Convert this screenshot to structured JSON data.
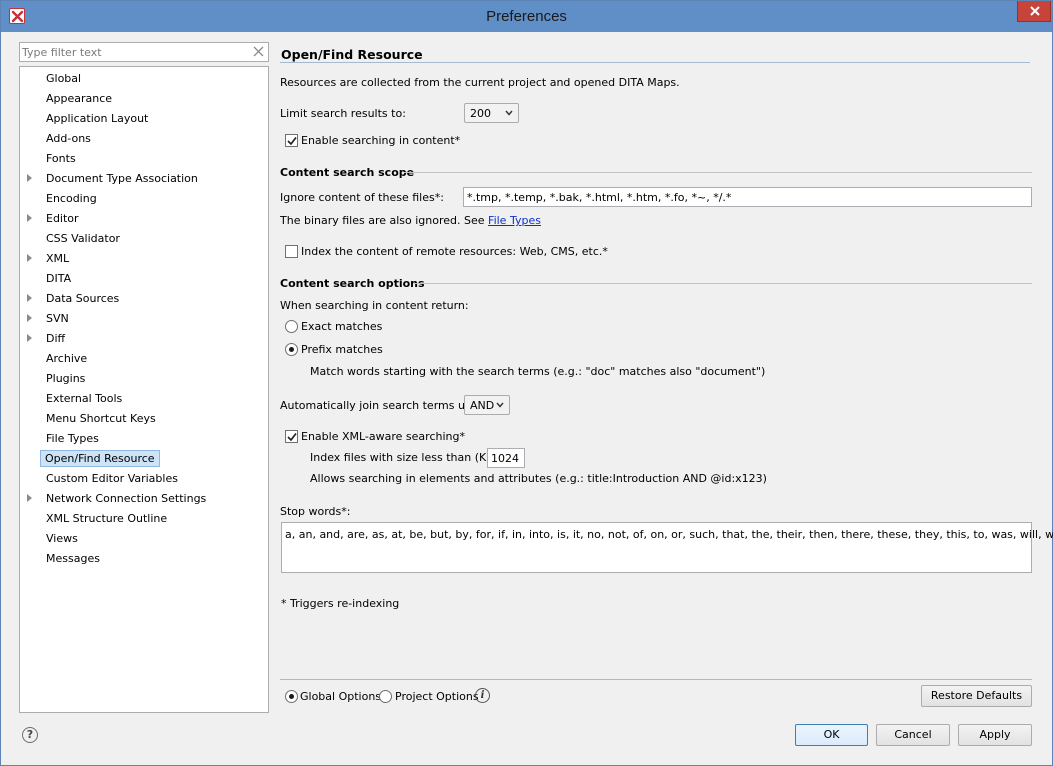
{
  "window": {
    "title": "Preferences"
  },
  "filter": {
    "placeholder": "Type filter text"
  },
  "tree": [
    {
      "label": "Global",
      "expandable": false
    },
    {
      "label": "Appearance",
      "expandable": false
    },
    {
      "label": "Application Layout",
      "expandable": false
    },
    {
      "label": "Add-ons",
      "expandable": false
    },
    {
      "label": "Fonts",
      "expandable": false
    },
    {
      "label": "Document Type Association",
      "expandable": true
    },
    {
      "label": "Encoding",
      "expandable": false
    },
    {
      "label": "Editor",
      "expandable": true
    },
    {
      "label": "CSS Validator",
      "expandable": false
    },
    {
      "label": "XML",
      "expandable": true
    },
    {
      "label": "DITA",
      "expandable": false
    },
    {
      "label": "Data Sources",
      "expandable": true
    },
    {
      "label": "SVN",
      "expandable": true
    },
    {
      "label": "Diff",
      "expandable": true
    },
    {
      "label": "Archive",
      "expandable": false
    },
    {
      "label": "Plugins",
      "expandable": false
    },
    {
      "label": "External Tools",
      "expandable": false
    },
    {
      "label": "Menu Shortcut Keys",
      "expandable": false
    },
    {
      "label": "File Types",
      "expandable": false
    },
    {
      "label": "Open/Find Resource",
      "expandable": false,
      "selected": true
    },
    {
      "label": "Custom Editor Variables",
      "expandable": false
    },
    {
      "label": "Network Connection Settings",
      "expandable": true
    },
    {
      "label": "XML Structure Outline",
      "expandable": false
    },
    {
      "label": "Views",
      "expandable": false
    },
    {
      "label": "Messages",
      "expandable": false
    }
  ],
  "page": {
    "title": "Open/Find Resource",
    "description": "Resources are collected from the current project and opened DITA Maps.",
    "limit_label": "Limit search results to:",
    "limit_value": "200",
    "enable_content_label": "Enable searching in content*",
    "enable_content_checked": true,
    "scope_heading": "Content search scope",
    "ignore_label": "Ignore content of these files*:",
    "ignore_value": "*.tmp, *.temp, *.bak, *.html, *.htm, *.fo, *~, */.*",
    "binary_text": "The binary files are also ignored. See",
    "file_types_link": "File Types",
    "remote_label": "Index the content of remote resources: Web, CMS, etc.*",
    "remote_checked": false,
    "options_heading": "Content search options",
    "return_label": "When searching in content return:",
    "exact_label": "Exact matches",
    "prefix_label": "Prefix matches",
    "prefix_selected": true,
    "prefix_desc": "Match words starting with the search terms (e.g.: \"doc\" matches also \"document\")",
    "join_label": "Automatically join search terms using:",
    "join_value": "AND",
    "xml_aware_label": "Enable XML-aware searching*",
    "xml_aware_checked": true,
    "index_size_label": "Index files with size less than (KB)*:",
    "index_size_value": "1024",
    "xml_aware_desc": "Allows searching in elements and attributes (e.g.: title:Introduction AND @id:x123)",
    "stop_words_label": "Stop words*:",
    "stop_words_value": "a, an, and, are, as, at, be, but, by, for, if, in, into, is, it, no, not, of, on, or, such, that, the, their, then, there, these, they, this, to, was, will, with",
    "reindex_note": "* Triggers re-indexing"
  },
  "footer": {
    "global_options": "Global Options",
    "project_options": "Project Options",
    "global_selected": true,
    "info_glyph": "i",
    "restore_defaults": "Restore Defaults",
    "help_glyph": "?",
    "ok": "OK",
    "cancel": "Cancel",
    "apply": "Apply"
  },
  "colors": {
    "titlebar": "#5f8fc6",
    "close": "#c7443b",
    "link": "#0b30c8",
    "selection": "#cde3f7"
  },
  "icons": [
    "app-logo-icon",
    "close-icon",
    "clear-filter-icon",
    "expand-arrow-icon",
    "checkmark-icon",
    "dropdown-arrow-icon",
    "info-icon",
    "help-icon"
  ]
}
